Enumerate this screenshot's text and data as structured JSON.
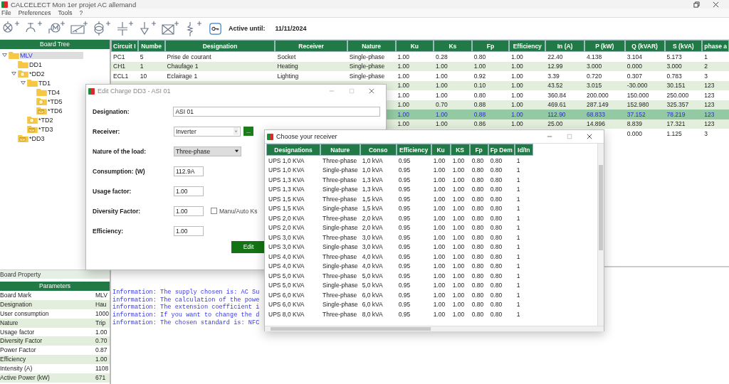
{
  "window": {
    "title": "CALCELECT Mon 1er projet AC allemand"
  },
  "menu": [
    "File",
    "Preferences",
    "Tools",
    "?"
  ],
  "license": {
    "label": "Active until:",
    "date": "11/11/2024"
  },
  "board_tree": {
    "title": "Board Tree",
    "nodes": [
      {
        "label": "MLV",
        "kind": "plain",
        "selected": true,
        "expanded": true,
        "children": [
          {
            "label": "DD1",
            "kind": "plain",
            "selected": false,
            "expanded": false
          },
          {
            "label": "*DD2",
            "kind": "gear",
            "selected": false,
            "expanded": true,
            "children": [
              {
                "label": "TD1",
                "kind": "plain",
                "selected": false,
                "expanded": true,
                "children": [
                  {
                    "label": "TD4",
                    "kind": "plain",
                    "selected": false,
                    "expanded": false
                  },
                  {
                    "label": "*TD5",
                    "kind": "gear",
                    "selected": false,
                    "expanded": false
                  },
                  {
                    "label": "*TD6",
                    "kind": "letter",
                    "selected": false,
                    "expanded": false
                  }
                ]
              },
              {
                "label": "*TD2",
                "kind": "gear",
                "selected": false,
                "expanded": false
              },
              {
                "label": "*TD3",
                "kind": "letter",
                "selected": false,
                "expanded": false
              }
            ]
          },
          {
            "label": "*DD3",
            "kind": "letter",
            "selected": false,
            "expanded": false
          }
        ]
      }
    ]
  },
  "board_property": {
    "title": "Board Property",
    "header": "Parameters",
    "rows": [
      {
        "name": "Board Mark",
        "value": "MLV"
      },
      {
        "name": "Designation",
        "value": "Hau"
      },
      {
        "name": "User consumption",
        "value": "1000"
      },
      {
        "name": "Nature",
        "value": "Trip"
      },
      {
        "name": "Usage factor",
        "value": "1.00"
      },
      {
        "name": "Diversity Factor",
        "value": "0.70"
      },
      {
        "name": "Power Factor",
        "value": "0.87"
      },
      {
        "name": "Efficiency",
        "value": "1.00"
      },
      {
        "name": "Intensity (A)",
        "value": "1108"
      },
      {
        "name": "Active Power (kW)",
        "value": "671"
      }
    ]
  },
  "circuits": {
    "columns": [
      "Circuit I",
      "Numbe",
      "Designation",
      "Receiver",
      "Nature",
      "Ku",
      "Ks",
      "Fp",
      "Efficiency",
      "In (A)",
      "P (kW)",
      "Q (kVAR)",
      "S (kVA)",
      "phase a"
    ],
    "rows": [
      {
        "selected": false,
        "cells": [
          "PC1",
          "5",
          "Prise de courant",
          "Socket",
          "Single-phase",
          "1.00",
          "0.28",
          "0.80",
          "1.00",
          "22.40",
          "4.138",
          "3.104",
          "5.173",
          "1"
        ]
      },
      {
        "selected": false,
        "cells": [
          "CH1",
          "1",
          "Chaufage 1",
          "Heating",
          "Single-phase",
          "1.00",
          "1.00",
          "1.00",
          "1.00",
          "12.99",
          "3.000",
          "0.000",
          "3.000",
          "2"
        ]
      },
      {
        "selected": false,
        "cells": [
          "ECL1",
          "10",
          "Eclairage 1",
          "Lighting",
          "Single-phase",
          "1.00",
          "1.00",
          "0.92",
          "1.00",
          "3.39",
          "0.720",
          "0.307",
          "0.783",
          "3"
        ]
      },
      {
        "selected": false,
        "cells": [
          "",
          "",
          "",
          "",
          "",
          "1.00",
          "1.00",
          "0.10",
          "1.00",
          "43.52",
          "3.015",
          "-30.000",
          "30.151",
          "123"
        ]
      },
      {
        "selected": false,
        "cells": [
          "",
          "",
          "",
          "",
          "",
          "1.00",
          "1.00",
          "0.80",
          "1.00",
          "360.84",
          "200.000",
          "150.000",
          "250.000",
          "123"
        ]
      },
      {
        "selected": false,
        "cells": [
          "",
          "",
          "",
          "",
          "",
          "1.00",
          "0.70",
          "0.88",
          "1.00",
          "469.61",
          "287.149",
          "152.980",
          "325.357",
          "123"
        ]
      },
      {
        "selected": true,
        "cells": [
          "",
          "",
          "",
          "",
          "",
          "1.00",
          "1.00",
          "0.88",
          "1.00",
          "112.90",
          "68.833",
          "37.152",
          "78.219",
          "123"
        ]
      },
      {
        "selected": false,
        "cells": [
          "",
          "",
          "",
          "",
          "",
          "1.00",
          "1.00",
          "0.86",
          "1.00",
          "25.00",
          "14.896",
          "8.839",
          "17.321",
          "123"
        ]
      },
      {
        "selected": false,
        "cells": [
          "",
          "",
          "",
          "",
          "",
          "",
          "",
          "",
          "",
          "",
          "",
          "0.000",
          "1.125",
          "3"
        ]
      }
    ]
  },
  "messages": [
    "Information: The supply chosen is: AC Su",
    "information: The calculation of the powe",
    "information: The extension coefficient i",
    "information: If you want to change the d",
    "information: The chosen standard is: NFC"
  ],
  "edit_dialog": {
    "title": "Edit Charge DD3 - ASI 01",
    "fields": [
      {
        "label": "Designation:",
        "kind": "text",
        "value": "ASI 01"
      },
      {
        "label": "Receiver:",
        "kind": "combo",
        "value": "Inverter",
        "button": "..."
      },
      {
        "label": "Nature of the load:",
        "kind": "select",
        "value": "Three-phase"
      },
      {
        "label": "Consumption: (W)",
        "kind": "short",
        "value": "112.9A"
      },
      {
        "label": "Usage factor:",
        "kind": "short",
        "value": "1.00"
      },
      {
        "label": "Diversity Factor:",
        "kind": "short",
        "value": "1.00",
        "checkbox": {
          "label": "Manu/Auto Ks",
          "checked": false
        }
      },
      {
        "label": "Efficiency:",
        "kind": "short",
        "value": "1.00"
      }
    ],
    "button": "Edit"
  },
  "receiver_dialog": {
    "title": "Choose your receiver",
    "columns": [
      "Designations",
      "Nature",
      "Conso",
      "Efficiency",
      "Ku",
      "KS",
      "Fp",
      "Fp Dem",
      "Id/In"
    ],
    "rows": [
      [
        "UPS 1,0 KVA",
        "Three-phase",
        "1,0 kVA",
        "0.95",
        "1.00",
        "1.00",
        "0.80",
        "0.80",
        "1"
      ],
      [
        "UPS 1,0 KVA",
        "Single-phase",
        "1,0 kVA",
        "0.95",
        "1.00",
        "1.00",
        "0.80",
        "0.80",
        "1"
      ],
      [
        "UPS 1,3 KVA",
        "Three-phase",
        "1,3 kVA",
        "0.95",
        "1.00",
        "1.00",
        "0.80",
        "0.80",
        "1"
      ],
      [
        "UPS 1,3 KVA",
        "Single-phase",
        "1,3 kVA",
        "0.95",
        "1.00",
        "1.00",
        "0.80",
        "0.80",
        "1"
      ],
      [
        "UPS 1,5 KVA",
        "Three-phase",
        "1,5 kVA",
        "0.95",
        "1.00",
        "1.00",
        "0.80",
        "0.80",
        "1"
      ],
      [
        "UPS 1,5 KVA",
        "Single-phase",
        "1,5 kVA",
        "0.95",
        "1.00",
        "1.00",
        "0.80",
        "0.80",
        "1"
      ],
      [
        "UPS 2,0 KVA",
        "Three-phase",
        "2,0 kVA",
        "0.95",
        "1.00",
        "1.00",
        "0.80",
        "0.80",
        "1"
      ],
      [
        "UPS 2,0 KVA",
        "Single-phase",
        "2,0 kVA",
        "0.95",
        "1.00",
        "1.00",
        "0.80",
        "0.80",
        "1"
      ],
      [
        "UPS 3,0 KVA",
        "Three-phase",
        "3,0 kVA",
        "0.95",
        "1.00",
        "1.00",
        "0.80",
        "0.80",
        "1"
      ],
      [
        "UPS 3,0 KVA",
        "Single-phase",
        "3,0 kVA",
        "0.95",
        "1.00",
        "1.00",
        "0.80",
        "0.80",
        "1"
      ],
      [
        "UPS 4,0 KVA",
        "Three-phase",
        "4,0 kVA",
        "0.95",
        "1.00",
        "1.00",
        "0.80",
        "0.80",
        "1"
      ],
      [
        "UPS 4,0 KVA",
        "Single-phase",
        "4,0 kVA",
        "0.95",
        "1.00",
        "1.00",
        "0.80",
        "0.80",
        "1"
      ],
      [
        "UPS 5,0 KVA",
        "Three-phase",
        "5,0 kVA",
        "0.95",
        "1.00",
        "1.00",
        "0.80",
        "0.80",
        "1"
      ],
      [
        "UPS 5,0 KVA",
        "Single-phase",
        "5,0 kVA",
        "0.95",
        "1.00",
        "1.00",
        "0.80",
        "0.80",
        "1"
      ],
      [
        "UPS 6,0 KVA",
        "Three-phase",
        "6,0 kVA",
        "0.95",
        "1.00",
        "1.00",
        "0.80",
        "0.80",
        "1"
      ],
      [
        "UPS 6,0 KVA",
        "Single-phase",
        "6,0 kVA",
        "0.95",
        "1.00",
        "1.00",
        "0.80",
        "0.80",
        "1"
      ],
      [
        "UPS 8,0 KVA",
        "Three-phase",
        "8,0 kVA",
        "0.95",
        "1.00",
        "1.00",
        "0.80",
        "0.80",
        "1"
      ]
    ]
  }
}
